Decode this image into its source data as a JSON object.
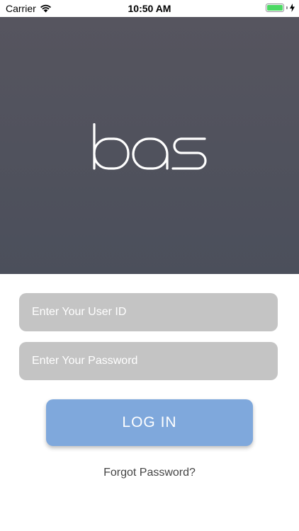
{
  "status_bar": {
    "carrier": "Carrier",
    "time": "10:50 AM",
    "wifi_icon": "wifi-icon",
    "battery_icon": "battery-icon",
    "charging_icon": "lightning-bolt-icon",
    "battery_level": 1.0
  },
  "hero": {
    "logo_text": "bas",
    "background_color": "#4f505b"
  },
  "form": {
    "user_id_placeholder": "Enter Your User ID",
    "user_id_value": "",
    "password_placeholder": "Enter Your Password",
    "password_value": "",
    "login_label": "LOG IN",
    "forgot_label": "Forgot Password?",
    "field_color": "#c4c4c4",
    "button_color": "#7fa8dc"
  }
}
